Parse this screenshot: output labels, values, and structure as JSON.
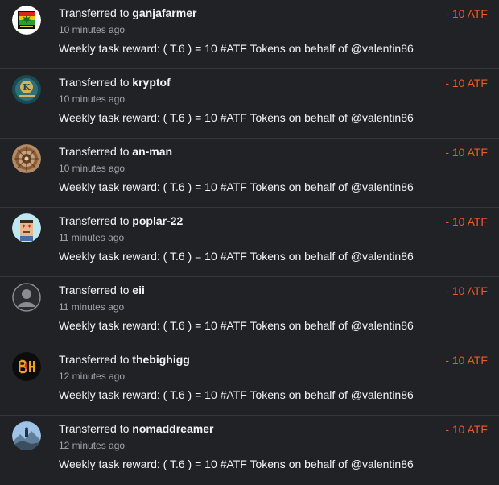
{
  "transfers": [
    {
      "prefix": "Transferred to",
      "user": "ganjafarmer",
      "time": "10 minutes ago",
      "memo": "Weekly task reward: ( T.6 ) = 10 #ATF Tokens on behalf of @valentin86",
      "amount": "- 10 ATF",
      "avatar": "ganjafarmer-logo"
    },
    {
      "prefix": "Transferred to",
      "user": "kryptof",
      "time": "10 minutes ago",
      "memo": "Weekly task reward: ( T.6 ) = 10 #ATF Tokens on behalf of @valentin86",
      "amount": "- 10 ATF",
      "avatar": "kryptof-coin-logo"
    },
    {
      "prefix": "Transferred to",
      "user": "an-man",
      "time": "10 minutes ago",
      "memo": "Weekly task reward: ( T.6 ) = 10 #ATF Tokens on behalf of @valentin86",
      "amount": "- 10 ATF",
      "avatar": "an-man-mandala"
    },
    {
      "prefix": "Transferred to",
      "user": "poplar-22",
      "time": "11 minutes ago",
      "memo": "Weekly task reward: ( T.6 ) = 10 #ATF Tokens on behalf of @valentin86",
      "amount": "- 10 ATF",
      "avatar": "poplar-pixel-face"
    },
    {
      "prefix": "Transferred to",
      "user": "eii",
      "time": "11 minutes ago",
      "memo": "Weekly task reward: ( T.6 ) = 10 #ATF Tokens on behalf of @valentin86",
      "amount": "- 10 ATF",
      "avatar": "default-user-icon"
    },
    {
      "prefix": "Transferred to",
      "user": "thebighigg",
      "time": "12 minutes ago",
      "memo": "Weekly task reward: ( T.6 ) = 10 #ATF Tokens on behalf of @valentin86",
      "amount": "- 10 ATF",
      "avatar": "bh-monogram-logo"
    },
    {
      "prefix": "Transferred to",
      "user": "nomaddreamer",
      "time": "12 minutes ago",
      "memo": "Weekly task reward: ( T.6 ) = 10 #ATF Tokens on behalf of @valentin86",
      "amount": "- 10 ATF",
      "avatar": "mountain-photo"
    }
  ],
  "colors": {
    "background": "#212226",
    "amount": "#ec5a2b",
    "muted": "#a3a5ab",
    "divider": "#35363a"
  }
}
